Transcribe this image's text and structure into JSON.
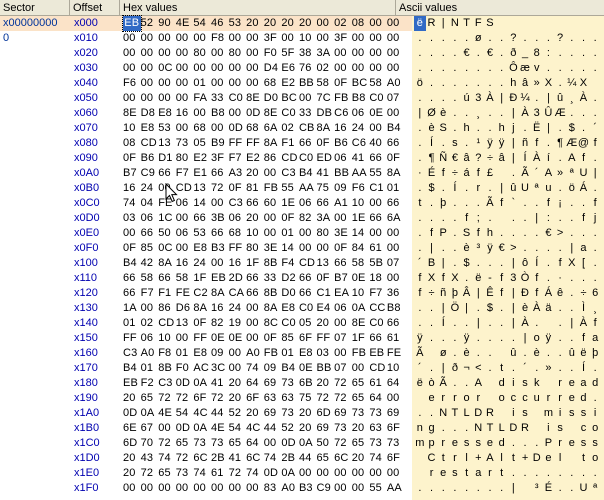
{
  "headers": {
    "sector": "Sector",
    "offset": "Offset",
    "hex": "Hex values",
    "ascii": "Ascii values"
  },
  "sectors": [
    "x00000000",
    "0"
  ],
  "rows": [
    {
      "off": "x000",
      "hex": [
        "EB",
        "52",
        "90",
        "4E",
        "54",
        "46",
        "53",
        "20",
        "20",
        "20",
        "20",
        "00",
        "02",
        "08",
        "00",
        "00"
      ],
      "ascii": [
        "ë",
        "R",
        "|",
        "N",
        "T",
        "F",
        "S",
        "",
        "",
        "",
        "",
        "",
        "",
        "",
        "",
        ""
      ]
    },
    {
      "off": "x010",
      "hex": [
        "00",
        "00",
        "00",
        "00",
        "00",
        "F8",
        "00",
        "00",
        "3F",
        "00",
        "10",
        "00",
        "3F",
        "00",
        "00",
        "00"
      ],
      "ascii": [
        ".",
        ".",
        ".",
        ".",
        ".",
        "ø",
        ".",
        ".",
        "?",
        ".",
        ".",
        ".",
        "?",
        ".",
        ".",
        "."
      ]
    },
    {
      "off": "x020",
      "hex": [
        "00",
        "00",
        "00",
        "00",
        "80",
        "00",
        "80",
        "00",
        "F0",
        "5F",
        "38",
        "3A",
        "00",
        "00",
        "00",
        "00"
      ],
      "ascii": [
        ".",
        ".",
        ".",
        ".",
        "€",
        ".",
        "€",
        ".",
        "ð",
        "_",
        "8",
        ":",
        ".",
        ".",
        ".",
        "."
      ]
    },
    {
      "off": "x030",
      "hex": [
        "00",
        "00",
        "0C",
        "00",
        "00",
        "00",
        "00",
        "00",
        "D4",
        "E6",
        "76",
        "02",
        "00",
        "00",
        "00",
        "00"
      ],
      "ascii": [
        ".",
        ".",
        ".",
        ".",
        ".",
        ".",
        ".",
        ".",
        "Ô",
        "æ",
        "v",
        ".",
        ".",
        ".",
        ".",
        "."
      ]
    },
    {
      "off": "x040",
      "hex": [
        "F6",
        "00",
        "00",
        "00",
        "01",
        "00",
        "00",
        "00",
        "68",
        "E2",
        "BB",
        "58",
        "0F",
        "BC",
        "58",
        "A0"
      ],
      "ascii": [
        "ö",
        ".",
        ".",
        ".",
        ".",
        ".",
        ".",
        ".",
        "h",
        "â",
        "»",
        "X",
        ".",
        "¼",
        "X",
        ""
      ]
    },
    {
      "off": "x050",
      "hex": [
        "00",
        "00",
        "00",
        "00",
        "FA",
        "33",
        "C0",
        "8E",
        "D0",
        "BC",
        "00",
        "7C",
        "FB",
        "B8",
        "C0",
        "07"
      ],
      "ascii": [
        ".",
        ".",
        ".",
        ".",
        "ú",
        "3",
        "À",
        "|",
        "Ð",
        "¼",
        ".",
        "|",
        "û",
        "¸",
        "À",
        "."
      ]
    },
    {
      "off": "x060",
      "hex": [
        "8E",
        "D8",
        "E8",
        "16",
        "00",
        "B8",
        "00",
        "0D",
        "8E",
        "C0",
        "33",
        "DB",
        "C6",
        "06",
        "0E",
        "00"
      ],
      "ascii": [
        "|",
        "Ø",
        "è",
        ".",
        ".",
        "¸",
        ".",
        ".",
        "|",
        "À",
        "3",
        "Û",
        "Æ",
        ".",
        ".",
        "."
      ]
    },
    {
      "off": "x070",
      "hex": [
        "10",
        "E8",
        "53",
        "00",
        "68",
        "00",
        "0D",
        "68",
        "6A",
        "02",
        "CB",
        "8A",
        "16",
        "24",
        "00",
        "B4"
      ],
      "ascii": [
        ".",
        "è",
        "S",
        ".",
        "h",
        ".",
        ".",
        "h",
        "j",
        ".",
        "Ë",
        "|",
        ".",
        "$",
        ".",
        "´"
      ]
    },
    {
      "off": "x080",
      "hex": [
        "08",
        "CD",
        "13",
        "73",
        "05",
        "B9",
        "FF",
        "FF",
        "8A",
        "F1",
        "66",
        "0F",
        "B6",
        "C6",
        "40",
        "66"
      ],
      "ascii": [
        ".",
        "Í",
        ".",
        "s",
        ".",
        "¹",
        "ÿ",
        "ÿ",
        "|",
        "ñ",
        "f",
        ".",
        "¶",
        "Æ",
        "@",
        "f"
      ]
    },
    {
      "off": "x090",
      "hex": [
        "0F",
        "B6",
        "D1",
        "80",
        "E2",
        "3F",
        "F7",
        "E2",
        "86",
        "CD",
        "C0",
        "ED",
        "06",
        "41",
        "66",
        "0F"
      ],
      "ascii": [
        ".",
        "¶",
        "Ñ",
        "€",
        "â",
        "?",
        "÷",
        "â",
        "|",
        "Í",
        "À",
        "í",
        ".",
        "A",
        "f",
        "."
      ]
    },
    {
      "off": "x0A0",
      "hex": [
        "B7",
        "C9",
        "66",
        "F7",
        "E1",
        "66",
        "A3",
        "20",
        "00",
        "C3",
        "B4",
        "41",
        "BB",
        "AA",
        "55",
        "8A"
      ],
      "ascii": [
        "·",
        "É",
        "f",
        "÷",
        "á",
        "f",
        "£",
        "",
        ".",
        "Ã",
        "´",
        "A",
        "»",
        "ª",
        "U",
        "|"
      ]
    },
    {
      "off": "x0B0",
      "hex": [
        "16",
        "24",
        "00",
        "CD",
        "13",
        "72",
        "0F",
        "81",
        "FB",
        "55",
        "AA",
        "75",
        "09",
        "F6",
        "C1",
        "01"
      ],
      "ascii": [
        ".",
        "$",
        ".",
        "Í",
        ".",
        "r",
        ".",
        "|",
        "û",
        "U",
        "ª",
        "u",
        ".",
        "ö",
        "Á",
        "."
      ]
    },
    {
      "off": "x0C0",
      "hex": [
        "74",
        "04",
        "FE",
        "06",
        "14",
        "00",
        "C3",
        "66",
        "60",
        "1E",
        "06",
        "66",
        "A1",
        "10",
        "00",
        "66"
      ],
      "ascii": [
        "t",
        ".",
        "þ",
        ".",
        ".",
        ".",
        "Ã",
        "f",
        "`",
        ".",
        ".",
        "f",
        "¡",
        ".",
        ".",
        "f"
      ]
    },
    {
      "off": "x0D0",
      "hex": [
        "03",
        "06",
        "1C",
        "00",
        "66",
        "3B",
        "06",
        "20",
        "00",
        "0F",
        "82",
        "3A",
        "00",
        "1E",
        "66",
        "6A"
      ],
      "ascii": [
        ".",
        ".",
        ".",
        ".",
        "f",
        ";",
        ".",
        "",
        ".",
        ".",
        "|",
        ":",
        ".",
        ".",
        "f",
        "j"
      ]
    },
    {
      "off": "x0E0",
      "hex": [
        "00",
        "66",
        "50",
        "06",
        "53",
        "66",
        "68",
        "10",
        "00",
        "01",
        "00",
        "80",
        "3E",
        "14",
        "00",
        "00"
      ],
      "ascii": [
        ".",
        "f",
        "P",
        ".",
        "S",
        "f",
        "h",
        ".",
        ".",
        ".",
        ".",
        "€",
        ">",
        ".",
        ".",
        "."
      ]
    },
    {
      "off": "x0F0",
      "hex": [
        "0F",
        "85",
        "0C",
        "00",
        "E8",
        "B3",
        "FF",
        "80",
        "3E",
        "14",
        "00",
        "00",
        "0F",
        "84",
        "61",
        "00"
      ],
      "ascii": [
        ".",
        "|",
        ".",
        ".",
        "è",
        "³",
        "ÿ",
        "€",
        ">",
        ".",
        ".",
        ".",
        ".",
        "|",
        "a",
        "."
      ]
    },
    {
      "off": "x100",
      "hex": [
        "B4",
        "42",
        "8A",
        "16",
        "24",
        "00",
        "16",
        "1F",
        "8B",
        "F4",
        "CD",
        "13",
        "66",
        "58",
        "5B",
        "07"
      ],
      "ascii": [
        "´",
        "B",
        "|",
        ".",
        "$",
        ".",
        ".",
        ".",
        "|",
        "ô",
        "Í",
        ".",
        "f",
        "X",
        "[",
        "."
      ]
    },
    {
      "off": "x110",
      "hex": [
        "66",
        "58",
        "66",
        "58",
        "1F",
        "EB",
        "2D",
        "66",
        "33",
        "D2",
        "66",
        "0F",
        "B7",
        "0E",
        "18",
        "00"
      ],
      "ascii": [
        "f",
        "X",
        "f",
        "X",
        ".",
        "ë",
        "-",
        "f",
        "3",
        "Ò",
        "f",
        ".",
        "·",
        ".",
        ".",
        "."
      ]
    },
    {
      "off": "x120",
      "hex": [
        "66",
        "F7",
        "F1",
        "FE",
        "C2",
        "8A",
        "CA",
        "66",
        "8B",
        "D0",
        "66",
        "C1",
        "EA",
        "10",
        "F7",
        "36"
      ],
      "ascii": [
        "f",
        "÷",
        "ñ",
        "þ",
        "Â",
        "|",
        "Ê",
        "f",
        "|",
        "Ð",
        "f",
        "Á",
        "ê",
        ".",
        "÷",
        "6"
      ]
    },
    {
      "off": "x130",
      "hex": [
        "1A",
        "00",
        "86",
        "D6",
        "8A",
        "16",
        "24",
        "00",
        "8A",
        "E8",
        "C0",
        "E4",
        "06",
        "0A",
        "CC",
        "B8"
      ],
      "ascii": [
        ".",
        ".",
        "|",
        "Ö",
        "|",
        ".",
        "$",
        ".",
        "|",
        "è",
        "À",
        "ä",
        ".",
        ".",
        "Ì",
        "¸"
      ]
    },
    {
      "off": "x140",
      "hex": [
        "01",
        "02",
        "CD",
        "13",
        "0F",
        "82",
        "19",
        "00",
        "8C",
        "C0",
        "05",
        "20",
        "00",
        "8E",
        "C0",
        "66"
      ],
      "ascii": [
        ".",
        ".",
        "Í",
        ".",
        ".",
        "|",
        ".",
        ".",
        "|",
        "À",
        ".",
        "",
        ".",
        "|",
        "À",
        "f"
      ]
    },
    {
      "off": "x150",
      "hex": [
        "FF",
        "06",
        "10",
        "00",
        "FF",
        "0E",
        "0E",
        "00",
        "0F",
        "85",
        "6F",
        "FF",
        "07",
        "1F",
        "66",
        "61"
      ],
      "ascii": [
        "ÿ",
        ".",
        ".",
        ".",
        "ÿ",
        ".",
        ".",
        ".",
        ".",
        "|",
        "o",
        "ÿ",
        ".",
        ".",
        "f",
        "a"
      ]
    },
    {
      "off": "x160",
      "hex": [
        "C3",
        "A0",
        "F8",
        "01",
        "E8",
        "09",
        "00",
        "A0",
        "FB",
        "01",
        "E8",
        "03",
        "00",
        "FB",
        "EB",
        "FE"
      ],
      "ascii": [
        "Ã",
        "",
        "ø",
        ".",
        "è",
        ".",
        ".",
        "",
        "û",
        ".",
        "è",
        ".",
        ".",
        "û",
        "ë",
        "þ"
      ]
    },
    {
      "off": "x170",
      "hex": [
        "B4",
        "01",
        "8B",
        "F0",
        "AC",
        "3C",
        "00",
        "74",
        "09",
        "B4",
        "0E",
        "BB",
        "07",
        "00",
        "CD",
        "10"
      ],
      "ascii": [
        "´",
        ".",
        "|",
        "ð",
        "¬",
        "<",
        ".",
        "t",
        ".",
        "´",
        ".",
        "»",
        ".",
        ".",
        "Í",
        "."
      ]
    },
    {
      "off": "x180",
      "hex": [
        "EB",
        "F2",
        "C3",
        "0D",
        "0A",
        "41",
        "20",
        "64",
        "69",
        "73",
        "6B",
        "20",
        "72",
        "65",
        "61",
        "64"
      ],
      "ascii": [
        "ë",
        "ò",
        "Ã",
        ".",
        ".",
        "A",
        "",
        "d",
        "i",
        "s",
        "k",
        "",
        "r",
        "e",
        "a",
        "d"
      ]
    },
    {
      "off": "x190",
      "hex": [
        "20",
        "65",
        "72",
        "72",
        "6F",
        "72",
        "20",
        "6F",
        "63",
        "63",
        "75",
        "72",
        "72",
        "65",
        "64",
        "00"
      ],
      "ascii": [
        "",
        "e",
        "r",
        "r",
        "o",
        "r",
        "",
        "o",
        "c",
        "c",
        "u",
        "r",
        "r",
        "e",
        "d",
        "."
      ]
    },
    {
      "off": "x1A0",
      "hex": [
        "0D",
        "0A",
        "4E",
        "54",
        "4C",
        "44",
        "52",
        "20",
        "69",
        "73",
        "20",
        "6D",
        "69",
        "73",
        "73",
        "69"
      ],
      "ascii": [
        ".",
        ".",
        "N",
        "T",
        "L",
        "D",
        "R",
        "",
        "i",
        "s",
        "",
        "m",
        "i",
        "s",
        "s",
        "i"
      ]
    },
    {
      "off": "x1B0",
      "hex": [
        "6E",
        "67",
        "00",
        "0D",
        "0A",
        "4E",
        "54",
        "4C",
        "44",
        "52",
        "20",
        "69",
        "73",
        "20",
        "63",
        "6F"
      ],
      "ascii": [
        "n",
        "g",
        ".",
        ".",
        ".",
        "N",
        "T",
        "L",
        "D",
        "R",
        "",
        "i",
        "s",
        "",
        "c",
        "o"
      ]
    },
    {
      "off": "x1C0",
      "hex": [
        "6D",
        "70",
        "72",
        "65",
        "73",
        "73",
        "65",
        "64",
        "00",
        "0D",
        "0A",
        "50",
        "72",
        "65",
        "73",
        "73"
      ],
      "ascii": [
        "m",
        "p",
        "r",
        "e",
        "s",
        "s",
        "e",
        "d",
        ".",
        ".",
        ".",
        "P",
        "r",
        "e",
        "s",
        "s"
      ]
    },
    {
      "off": "x1D0",
      "hex": [
        "20",
        "43",
        "74",
        "72",
        "6C",
        "2B",
        "41",
        "6C",
        "74",
        "2B",
        "44",
        "65",
        "6C",
        "20",
        "74",
        "6F"
      ],
      "ascii": [
        "",
        "C",
        "t",
        "r",
        "l",
        "+",
        "A",
        "l",
        "t",
        "+",
        "D",
        "e",
        "l",
        "",
        "t",
        "o"
      ]
    },
    {
      "off": "x1E0",
      "hex": [
        "20",
        "72",
        "65",
        "73",
        "74",
        "61",
        "72",
        "74",
        "0D",
        "0A",
        "00",
        "00",
        "00",
        "00",
        "00",
        "00"
      ],
      "ascii": [
        "",
        "r",
        "e",
        "s",
        "t",
        "a",
        "r",
        "t",
        ".",
        ".",
        ".",
        ".",
        ".",
        ".",
        ".",
        "."
      ]
    },
    {
      "off": "x1F0",
      "hex": [
        "00",
        "00",
        "00",
        "00",
        "00",
        "00",
        "00",
        "00",
        "83",
        "A0",
        "B3",
        "C9",
        "00",
        "00",
        "55",
        "AA"
      ],
      "ascii": [
        ".",
        ".",
        ".",
        ".",
        ".",
        ".",
        ".",
        ".",
        "|",
        "",
        "³",
        "É",
        ".",
        ".",
        "U",
        "ª"
      ]
    }
  ]
}
